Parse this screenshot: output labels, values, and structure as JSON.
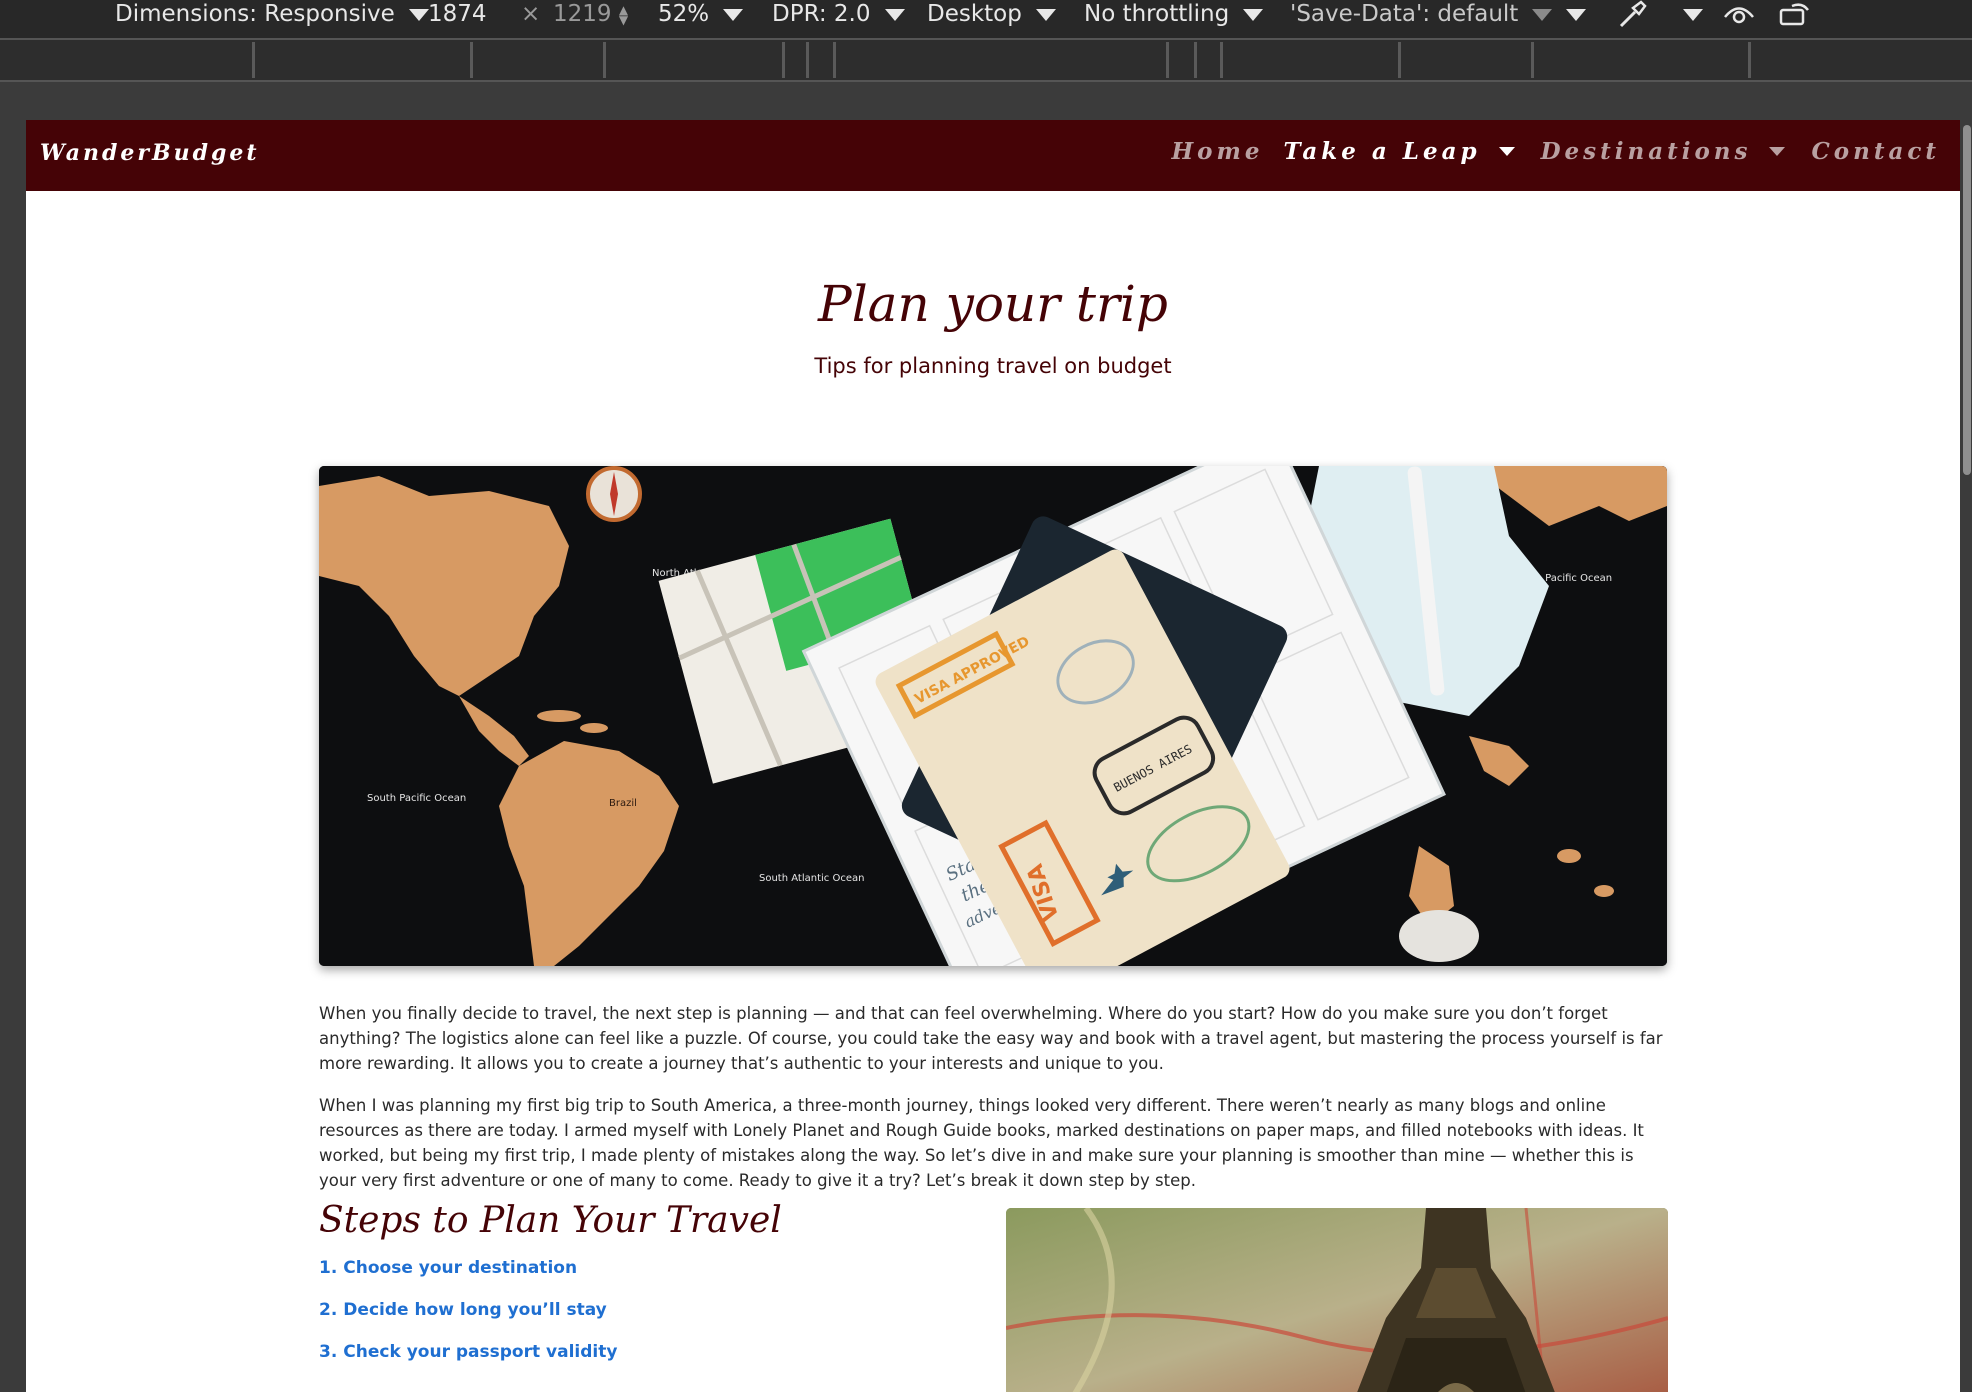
{
  "devtools": {
    "dimensions_label": "Dimensions: Responsive",
    "width_value": "1874",
    "times_sign": "×",
    "height_value": "1219",
    "zoom": "52%",
    "dpr": "DPR: 2.0",
    "device_mode": "Desktop",
    "throttling": "No throttling",
    "save_data": "'Save-Data': default",
    "icons": [
      "more-options-icon",
      "eyedropper-icon",
      "eye-icon",
      "rotate-icon"
    ]
  },
  "site": {
    "brand": "WanderBudget",
    "nav": [
      {
        "label": "Home",
        "active": false,
        "dropdown": false
      },
      {
        "label": "Take a Leap",
        "active": true,
        "dropdown": true
      },
      {
        "label": "Destinations",
        "active": false,
        "dropdown": true
      },
      {
        "label": "Contact",
        "active": false,
        "dropdown": false
      }
    ]
  },
  "hero": {
    "title": "Plan your trip",
    "subtitle": "Tips for planning travel on budget",
    "map_labels": [
      "North Atlantic Ocean",
      "North Pacific Ocean",
      "South Pacific Ocean",
      "South Atlantic Ocean",
      "Brazil"
    ]
  },
  "article": {
    "paragraph1": "When you finally decide to travel, the next step is planning — and that can feel overwhelming. Where do you start? How do you make sure you don’t forget anything? The logistics alone can feel like a puzzle. Of course, you could take the easy way and book with a travel agent, but mastering the process yourself is far more rewarding. It allows you to create a journey that’s authentic to your interests and unique to you.",
    "paragraph2": "When I was planning my first big trip to South America, a three-month journey, things looked very different. There weren’t nearly as many blogs and online resources as there are today. I armed myself with Lonely Planet and Rough Guide books, marked destinations on paper maps, and filled notebooks with ideas. It worked, but being my first trip, I made plenty of mistakes along the way. So let’s dive in and make sure your planning is smoother than mine — whether this is your very first adventure or one of many to come. Ready to give it a try? Let’s break it down step by step.",
    "steps_heading": "Steps to Plan Your Travel",
    "steps": [
      {
        "num": "1.",
        "label": "Choose your destination"
      },
      {
        "num": "2.",
        "label": "Decide how long you’ll stay"
      },
      {
        "num": "3.",
        "label": "Check your passport validity"
      }
    ]
  },
  "colors": {
    "brand": "#450306",
    "link": "#1f6fd1",
    "devtools_bg": "#282828"
  }
}
